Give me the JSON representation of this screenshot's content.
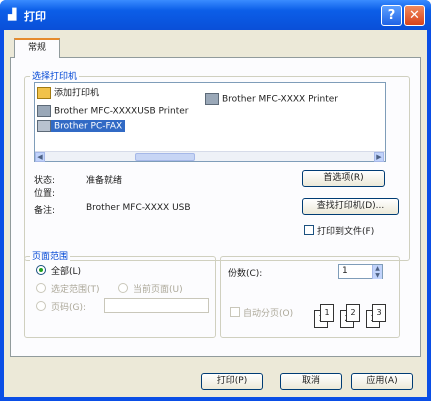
{
  "window": {
    "title": "打印",
    "help": "?",
    "close": "✕"
  },
  "tabs": [
    {
      "label": "常规"
    }
  ],
  "select_printer": {
    "group_label": "选择打印机",
    "printers": [
      {
        "label": "添加打印机",
        "icon": "add-printer-icon"
      },
      {
        "label": "Brother MFC-XXXXUSB Printer",
        "icon": "printer-icon"
      },
      {
        "label": "Brother PC-FAX",
        "icon": "fax-printer-icon",
        "selected": true
      },
      {
        "label": "Brother MFC-XXXX Printer",
        "icon": "printer-icon"
      }
    ]
  },
  "status": {
    "state_label": "状态:",
    "state_value": "准备就绪",
    "location_label": "位置:",
    "location_value": "",
    "comment_label": "备注:",
    "comment_value": "Brother MFC-XXXX USB"
  },
  "buttons": {
    "preferences": "首选项(R)",
    "find_printer": "查找打印机(D)...",
    "print": "打印(P)",
    "cancel": "取消",
    "apply": "应用(A)"
  },
  "print_to_file": {
    "label": "打印到文件(F)",
    "checked": false
  },
  "page_range": {
    "group_label": "页面范围",
    "all": "全部(L)",
    "selection": "选定范围(T)",
    "current_page": "当前页面(U)",
    "pages": "页码(G):",
    "pages_value": "",
    "selected": "all"
  },
  "copies": {
    "label": "份数(C):",
    "value": "1",
    "collate": "自动分页(O)",
    "collate_checked": false,
    "page_labels": [
      "1",
      "1",
      "2",
      "2",
      "3",
      "3"
    ]
  }
}
